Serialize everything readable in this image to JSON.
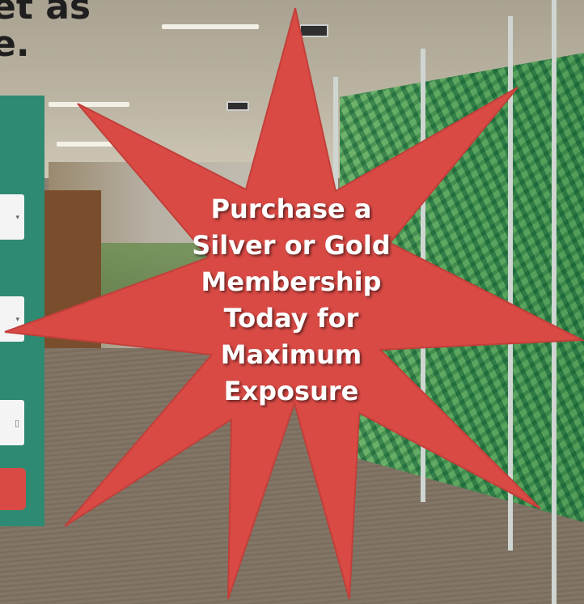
{
  "heading": {
    "lines": [
      "et as",
      "e."
    ]
  },
  "promo": {
    "lines": [
      "Purchase a",
      "Silver or Gold",
      "Membership",
      "Today for",
      "Maximum",
      "Exposure"
    ],
    "burst_color": "#d94a45",
    "text_color": "#ffffff"
  },
  "form": {
    "panel_color": "#2e8a72",
    "fields": [
      {
        "icon": "chevron-down-icon",
        "glyph": "▾"
      },
      {
        "icon": "chevron-down-icon",
        "glyph": "▾"
      },
      {
        "icon": "calendar-icon",
        "glyph": "▯"
      }
    ],
    "submit_color": "#d94a45"
  }
}
